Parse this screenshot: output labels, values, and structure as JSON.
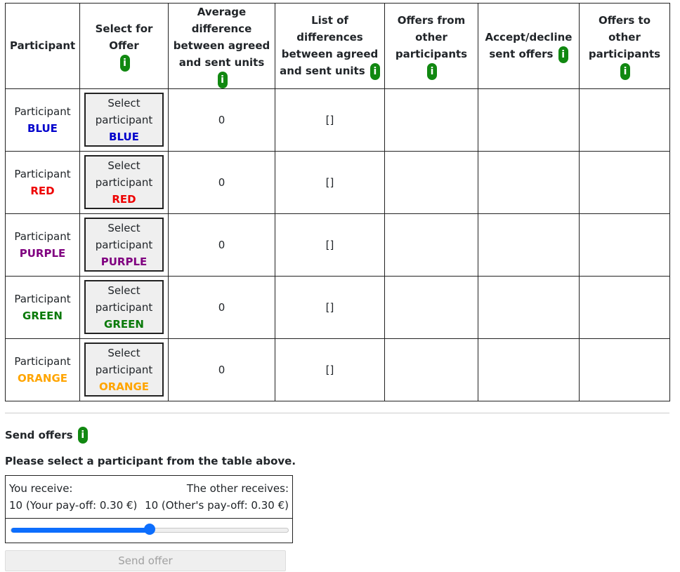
{
  "headers": {
    "participant": "Participant",
    "select": "Select for Offer",
    "avg_diff": "Average difference between agreed and sent units",
    "list_diff": "List of differences between agreed and sent units",
    "offers_from": "Offers from other participants",
    "accept_decline": "Accept/decline sent offers",
    "offers_to": "Offers to other participants"
  },
  "info_icon_label": "i",
  "participants": [
    {
      "prefix": "Participant",
      "color_name": "BLUE",
      "color": "#0000cc",
      "select_line1": "Select",
      "select_line2": "participant",
      "avg_diff": "0",
      "diff_list": "[]"
    },
    {
      "prefix": "Participant",
      "color_name": "RED",
      "color": "#ee0000",
      "select_line1": "Select",
      "select_line2": "participant",
      "avg_diff": "0",
      "diff_list": "[]"
    },
    {
      "prefix": "Participant",
      "color_name": "PURPLE",
      "color": "#800080",
      "select_line1": "Select",
      "select_line2": "participant",
      "avg_diff": "0",
      "diff_list": "[]"
    },
    {
      "prefix": "Participant",
      "color_name": "GREEN",
      "color": "#0a7a0a",
      "select_line1": "Select",
      "select_line2": "participant",
      "avg_diff": "0",
      "diff_list": "[]"
    },
    {
      "prefix": "Participant",
      "color_name": "ORANGE",
      "color": "#ffa500",
      "select_line1": "Select",
      "select_line2": "participant",
      "avg_diff": "0",
      "diff_list": "[]"
    }
  ],
  "send": {
    "title": "Send offers",
    "prompt": "Please select a participant from the table above.",
    "you_receive_label": "You receive:",
    "other_receives_label": "The other receives:",
    "you_value": "10 (Your pay-off: 0.30 €)",
    "other_value": "10 (Other's pay-off: 0.30 €)",
    "slider_fraction": 0.5,
    "button_label": "Send offer"
  },
  "colors": {
    "info_badge": "#118811",
    "slider_accent": "#0d6efd"
  }
}
